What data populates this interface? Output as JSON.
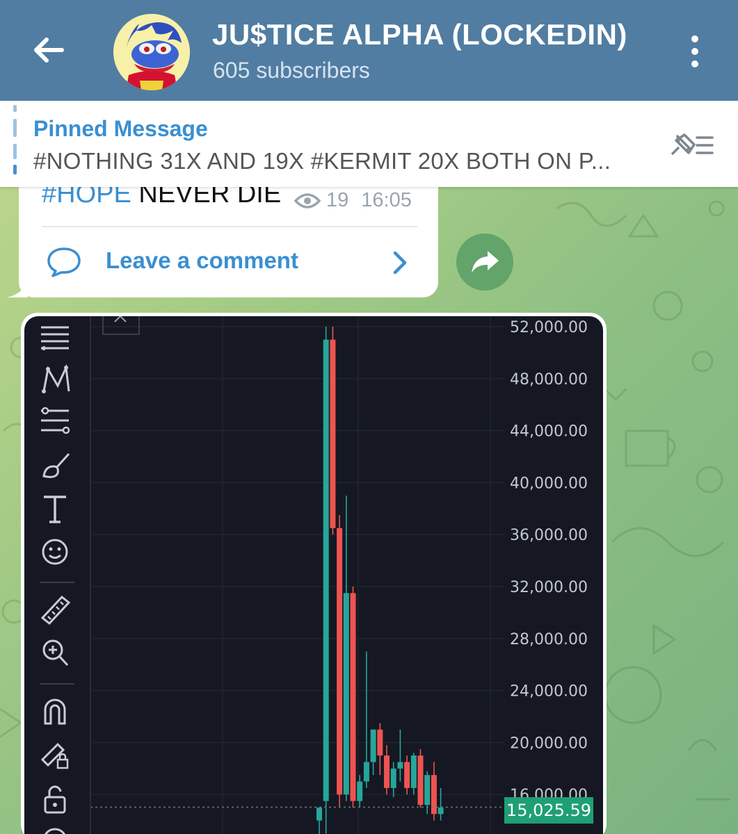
{
  "header": {
    "title": "JU$TICE ALPHA (LOCKEDIN)",
    "subscribers": "605 subscribers"
  },
  "pinned": {
    "title": "Pinned Message",
    "text": "#NOTHING  31X AND 19X  #KERMIT 20X   BOTH ON P..."
  },
  "message": {
    "hashtag": "#HOPE",
    "text": " NEVER DIE",
    "views": "19",
    "time": "16:05",
    "comment_label": "Leave a comment"
  },
  "chart": {
    "current_price": "15,025.59",
    "colors": {
      "up": "#26a69a",
      "down": "#ef5350",
      "bg": "#151823",
      "price_tag": "#1f9f75"
    }
  },
  "chart_data": {
    "type": "candlestick",
    "y_tick_labels": [
      "52,000.00",
      "48,000.00",
      "44,000.00",
      "40,000.00",
      "36,000.00",
      "32,000.00",
      "28,000.00",
      "24,000.00",
      "20,000.00",
      "16,000.00"
    ],
    "y_ticks": [
      52000,
      48000,
      44000,
      40000,
      36000,
      32000,
      28000,
      24000,
      20000,
      16000
    ],
    "ylim": [
      12000,
      52500
    ],
    "current_price": 15025.59,
    "candles": [
      {
        "o": 14000,
        "h": 14500,
        "l": 12000,
        "c": 15000
      },
      {
        "o": 15500,
        "h": 52000,
        "l": 13000,
        "c": 51000
      },
      {
        "o": 51000,
        "h": 52000,
        "l": 36000,
        "c": 36500
      },
      {
        "o": 36500,
        "h": 37500,
        "l": 15000,
        "c": 16000
      },
      {
        "o": 16000,
        "h": 39000,
        "l": 15500,
        "c": 31500
      },
      {
        "o": 31500,
        "h": 32000,
        "l": 15000,
        "c": 15500
      },
      {
        "o": 15500,
        "h": 17500,
        "l": 15000,
        "c": 17000
      },
      {
        "o": 17000,
        "h": 27000,
        "l": 16500,
        "c": 18500
      },
      {
        "o": 18500,
        "h": 21000,
        "l": 17500,
        "c": 21000
      },
      {
        "o": 21000,
        "h": 21500,
        "l": 17500,
        "c": 19000
      },
      {
        "o": 19000,
        "h": 19800,
        "l": 16000,
        "c": 16500
      },
      {
        "o": 16500,
        "h": 18500,
        "l": 15800,
        "c": 18000
      },
      {
        "o": 18000,
        "h": 21000,
        "l": 17000,
        "c": 18500
      },
      {
        "o": 18500,
        "h": 19000,
        "l": 16000,
        "c": 16500
      },
      {
        "o": 16500,
        "h": 19200,
        "l": 16000,
        "c": 19000
      },
      {
        "o": 19000,
        "h": 19500,
        "l": 15000,
        "c": 15200
      },
      {
        "o": 15200,
        "h": 17800,
        "l": 14500,
        "c": 17500
      },
      {
        "o": 17500,
        "h": 18500,
        "l": 14000,
        "c": 14500
      },
      {
        "o": 14500,
        "h": 16500,
        "l": 14000,
        "c": 15000
      }
    ]
  }
}
